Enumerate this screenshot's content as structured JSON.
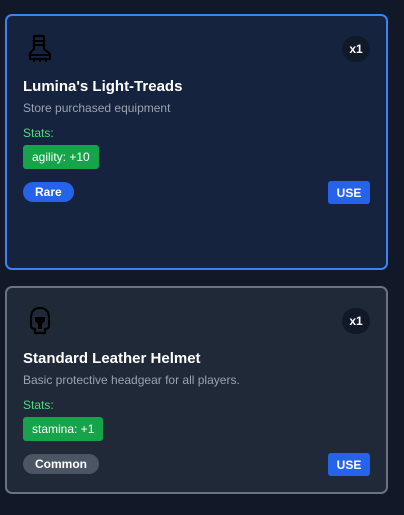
{
  "items": [
    {
      "icon": "boot-icon",
      "quantity": "x1",
      "name": "Lumina's Light-Treads",
      "description": "Store purchased equipment",
      "stats_label": "Stats:",
      "stat": "agility: +10",
      "rarity": "Rare",
      "action_label": "USE",
      "selected": true
    },
    {
      "icon": "helmet-icon",
      "quantity": "x1",
      "name": "Standard Leather Helmet",
      "description": "Basic protective headgear for all players.",
      "stats_label": "Stats:",
      "stat": "stamina: +1",
      "rarity": "Common",
      "action_label": "USE",
      "selected": false
    }
  ],
  "colors": {
    "page_background": "#111827",
    "selected_border": "#3b82f6",
    "stat_green": "#16a34a",
    "rare_badge": "#2563eb",
    "common_badge": "#4b5563",
    "use_button": "#2563eb"
  }
}
